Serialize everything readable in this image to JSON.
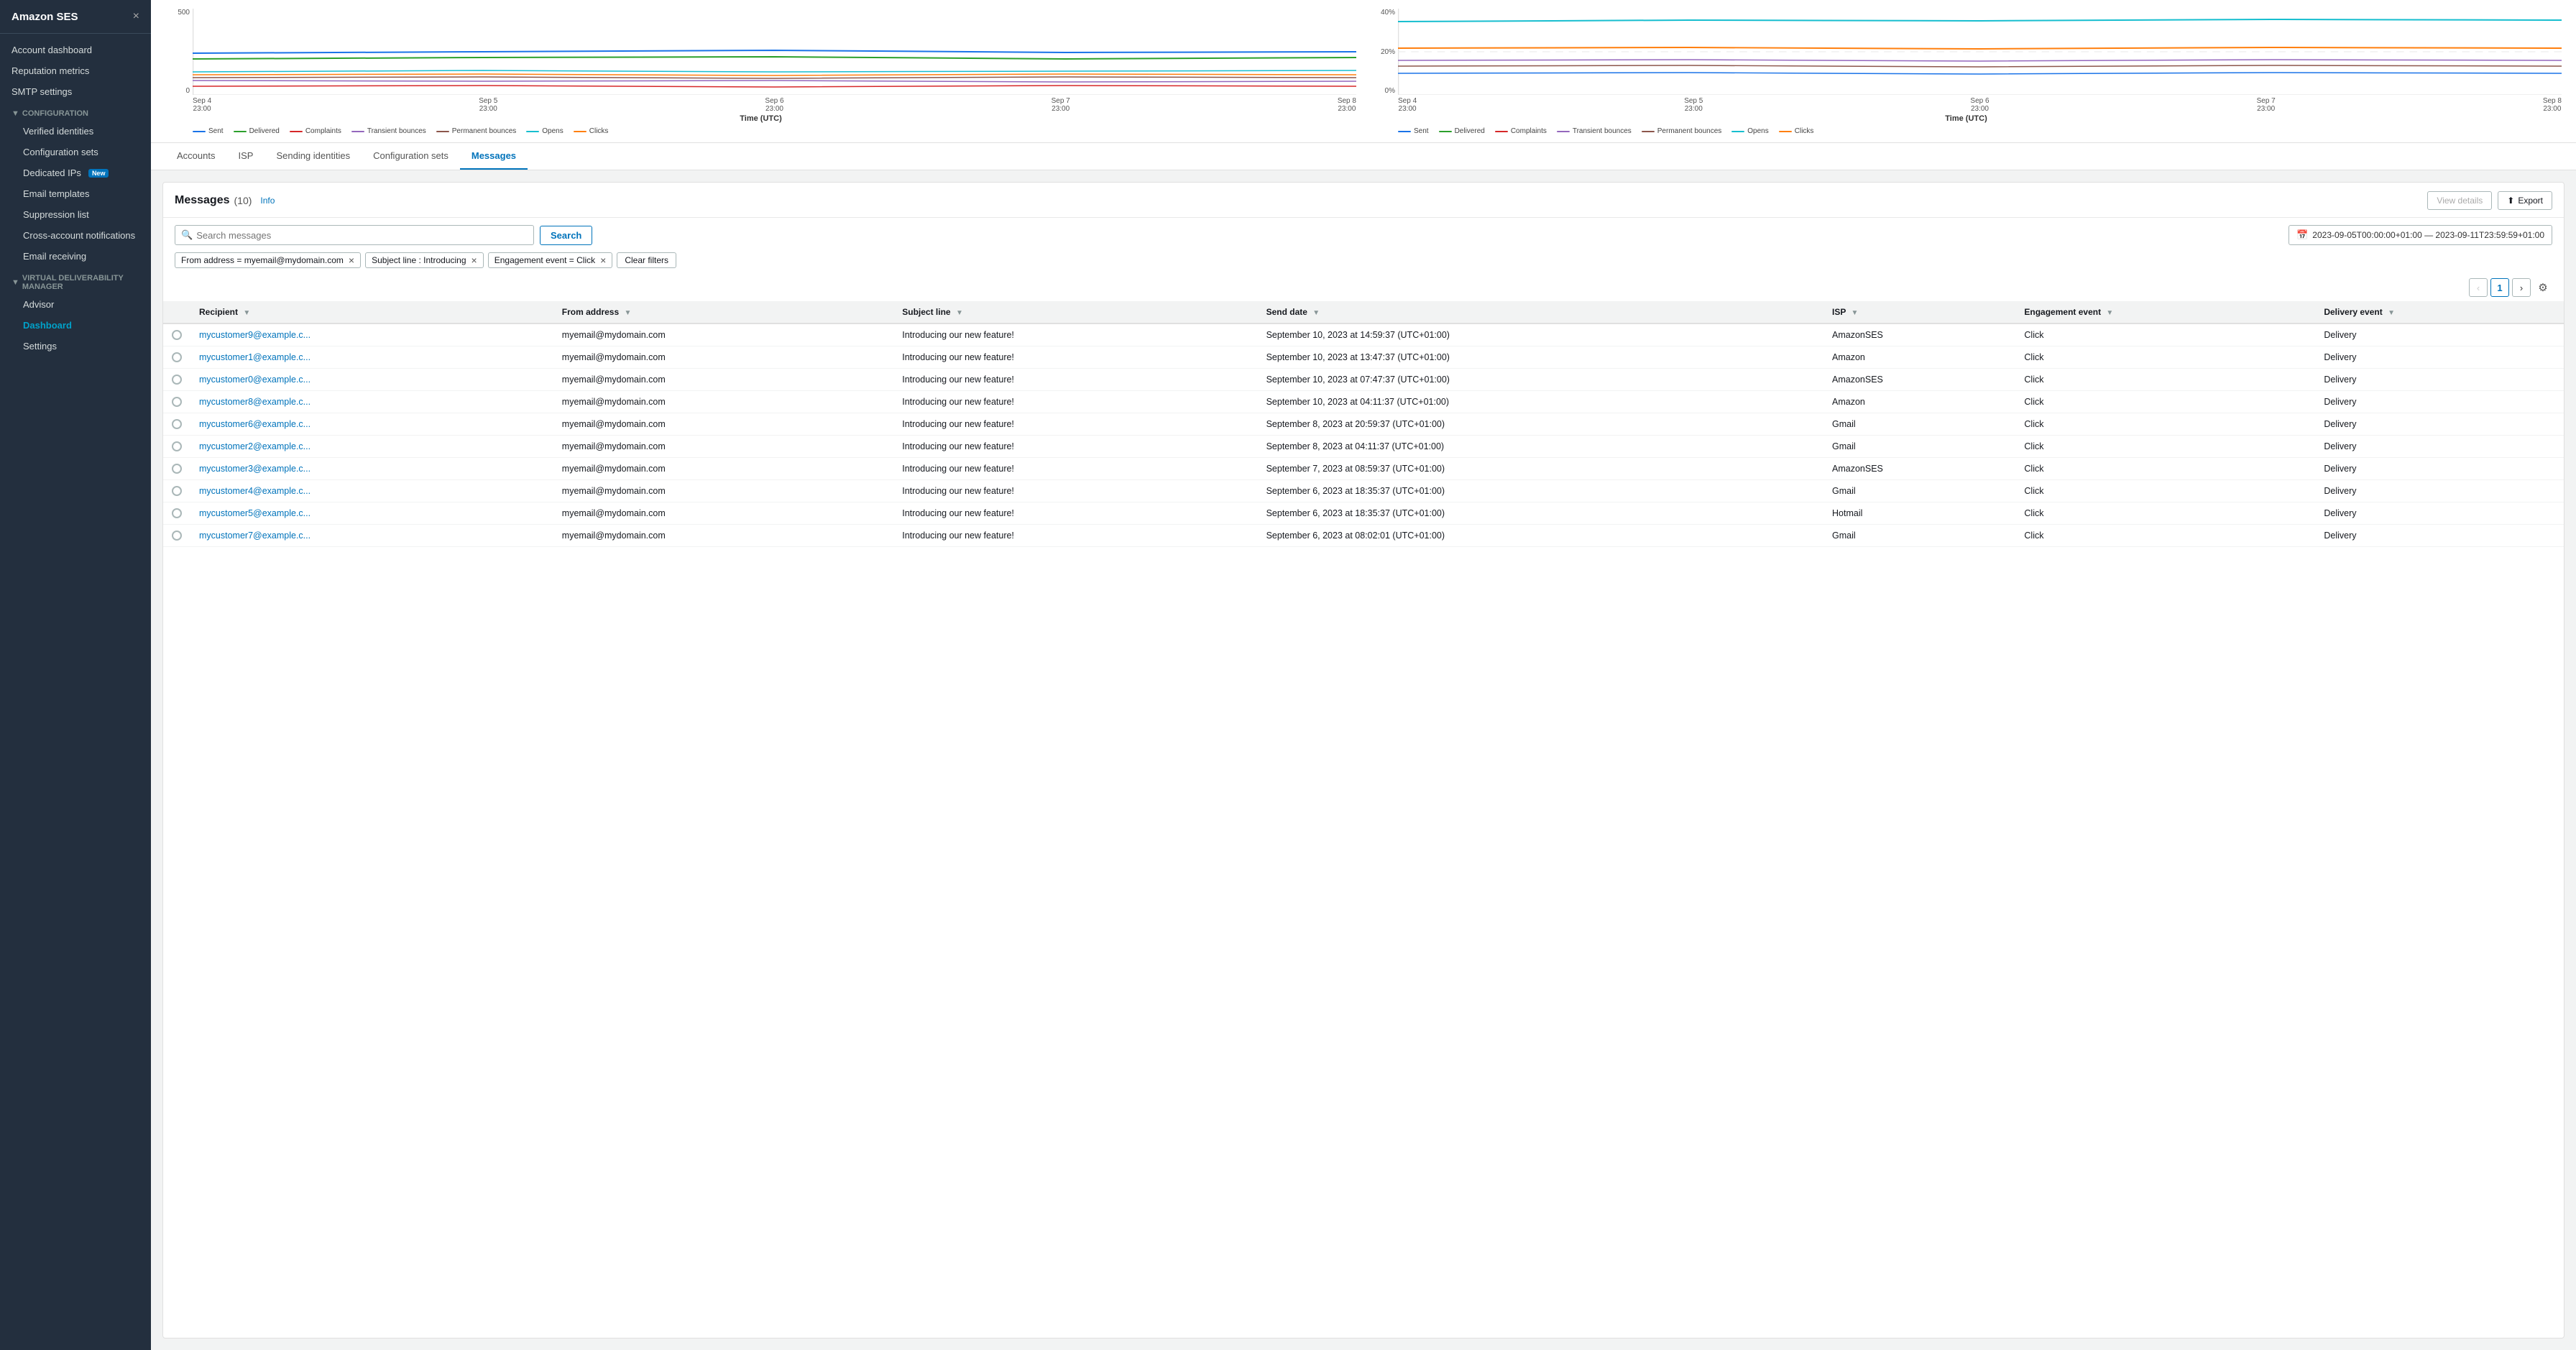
{
  "sidebar": {
    "title": "Amazon SES",
    "close_icon": "×",
    "nav": [
      {
        "id": "account-dashboard",
        "label": "Account dashboard",
        "level": "top"
      },
      {
        "id": "reputation-metrics",
        "label": "Reputation metrics",
        "level": "top"
      },
      {
        "id": "smtp-settings",
        "label": "SMTP settings",
        "level": "top"
      },
      {
        "id": "configuration-section",
        "label": "Configuration",
        "level": "section"
      },
      {
        "id": "verified-identities",
        "label": "Verified identities",
        "level": "sub"
      },
      {
        "id": "configuration-sets",
        "label": "Configuration sets",
        "level": "sub"
      },
      {
        "id": "dedicated-ips",
        "label": "Dedicated IPs",
        "level": "sub",
        "badge": "New"
      },
      {
        "id": "email-templates",
        "label": "Email templates",
        "level": "sub"
      },
      {
        "id": "suppression-list",
        "label": "Suppression list",
        "level": "sub"
      },
      {
        "id": "cross-account-notifications",
        "label": "Cross-account notifications",
        "level": "sub"
      },
      {
        "id": "email-receiving",
        "label": "Email receiving",
        "level": "sub"
      },
      {
        "id": "vdm-section",
        "label": "Virtual Deliverability Manager",
        "level": "section"
      },
      {
        "id": "advisor",
        "label": "Advisor",
        "level": "sub"
      },
      {
        "id": "dashboard",
        "label": "Dashboard",
        "level": "sub",
        "active": true
      },
      {
        "id": "settings",
        "label": "Settings",
        "level": "sub"
      }
    ]
  },
  "charts": {
    "left": {
      "y_labels": [
        "500",
        "0"
      ],
      "x_labels": [
        "Sep 4\n23:00",
        "Sep 5\n23:00",
        "Sep 6\n23:00",
        "Sep 7\n23:00",
        "Sep 8\n23:00"
      ],
      "x_title": "Time (UTC)",
      "legend": [
        {
          "label": "Sent",
          "color": "#1a73e8"
        },
        {
          "label": "Delivered",
          "color": "#2ca02c"
        },
        {
          "label": "Complaints",
          "color": "#d62728"
        },
        {
          "label": "Transient bounces",
          "color": "#9467bd"
        },
        {
          "label": "Permanent bounces",
          "color": "#8c564b"
        },
        {
          "label": "Opens",
          "color": "#17becf"
        },
        {
          "label": "Clicks",
          "color": "#ff7f0e"
        }
      ]
    },
    "right": {
      "y_labels": [
        "40%",
        "20%",
        "0%"
      ],
      "x_labels": [
        "Sep 4\n23:00",
        "Sep 5\n23:00",
        "Sep 6\n23:00",
        "Sep 7\n23:00",
        "Sep 8\n23:00"
      ],
      "x_title": "Time (UTC)",
      "legend": [
        {
          "label": "Sent",
          "color": "#1a73e8"
        },
        {
          "label": "Delivered",
          "color": "#2ca02c"
        },
        {
          "label": "Complaints",
          "color": "#d62728"
        },
        {
          "label": "Transient bounces",
          "color": "#9467bd"
        },
        {
          "label": "Permanent bounces",
          "color": "#8c564b"
        },
        {
          "label": "Opens",
          "color": "#17becf"
        },
        {
          "label": "Clicks",
          "color": "#ff7f0e"
        }
      ]
    }
  },
  "tabs": [
    {
      "id": "accounts",
      "label": "Accounts"
    },
    {
      "id": "isp",
      "label": "ISP"
    },
    {
      "id": "sending-identities",
      "label": "Sending identities"
    },
    {
      "id": "configuration-sets",
      "label": "Configuration sets"
    },
    {
      "id": "messages",
      "label": "Messages",
      "active": true
    }
  ],
  "messages": {
    "title": "Messages",
    "count": "(10)",
    "info_label": "Info",
    "view_details_label": "View details",
    "export_label": "Export",
    "export_icon": "📤",
    "search_placeholder": "Search messages",
    "search_label": "Search",
    "date_range": "2023-09-05T00:00:00+01:00 — 2023-09-11T23:59:59+01:00",
    "filters": [
      {
        "id": "from-address",
        "label": "From address = myemail@mydomain.com"
      },
      {
        "id": "subject-line",
        "label": "Subject line : Introducing"
      },
      {
        "id": "engagement-event",
        "label": "Engagement event = Click"
      }
    ],
    "clear_filters_label": "Clear filters",
    "pagination": {
      "prev_disabled": true,
      "page": "1",
      "next_disabled": false
    },
    "columns": [
      {
        "id": "select",
        "label": ""
      },
      {
        "id": "recipient",
        "label": "Recipient"
      },
      {
        "id": "from-address",
        "label": "From address"
      },
      {
        "id": "subject-line",
        "label": "Subject line"
      },
      {
        "id": "send-date",
        "label": "Send date"
      },
      {
        "id": "isp",
        "label": "ISP"
      },
      {
        "id": "engagement-event",
        "label": "Engagement event"
      },
      {
        "id": "delivery-event",
        "label": "Delivery event"
      }
    ],
    "rows": [
      {
        "recipient": "mycustomer9@example.c...",
        "from": "myemail@mydomain.com",
        "subject": "Introducing our new feature!",
        "send_date": "September 10, 2023 at 14:59:37 (UTC+01:00)",
        "isp": "AmazonSES",
        "engagement": "Click",
        "delivery": "Delivery"
      },
      {
        "recipient": "mycustomer1@example.c...",
        "from": "myemail@mydomain.com",
        "subject": "Introducing our new feature!",
        "send_date": "September 10, 2023 at 13:47:37 (UTC+01:00)",
        "isp": "Amazon",
        "engagement": "Click",
        "delivery": "Delivery"
      },
      {
        "recipient": "mycustomer0@example.c...",
        "from": "myemail@mydomain.com",
        "subject": "Introducing our new feature!",
        "send_date": "September 10, 2023 at 07:47:37 (UTC+01:00)",
        "isp": "AmazonSES",
        "engagement": "Click",
        "delivery": "Delivery"
      },
      {
        "recipient": "mycustomer8@example.c...",
        "from": "myemail@mydomain.com",
        "subject": "Introducing our new feature!",
        "send_date": "September 10, 2023 at 04:11:37 (UTC+01:00)",
        "isp": "Amazon",
        "engagement": "Click",
        "delivery": "Delivery"
      },
      {
        "recipient": "mycustomer6@example.c...",
        "from": "myemail@mydomain.com",
        "subject": "Introducing our new feature!",
        "send_date": "September 8, 2023 at 20:59:37 (UTC+01:00)",
        "isp": "Gmail",
        "engagement": "Click",
        "delivery": "Delivery"
      },
      {
        "recipient": "mycustomer2@example.c...",
        "from": "myemail@mydomain.com",
        "subject": "Introducing our new feature!",
        "send_date": "September 8, 2023 at 04:11:37 (UTC+01:00)",
        "isp": "Gmail",
        "engagement": "Click",
        "delivery": "Delivery"
      },
      {
        "recipient": "mycustomer3@example.c...",
        "from": "myemail@mydomain.com",
        "subject": "Introducing our new feature!",
        "send_date": "September 7, 2023 at 08:59:37 (UTC+01:00)",
        "isp": "AmazonSES",
        "engagement": "Click",
        "delivery": "Delivery"
      },
      {
        "recipient": "mycustomer4@example.c...",
        "from": "myemail@mydomain.com",
        "subject": "Introducing our new feature!",
        "send_date": "September 6, 2023 at 18:35:37 (UTC+01:00)",
        "isp": "Gmail",
        "engagement": "Click",
        "delivery": "Delivery"
      },
      {
        "recipient": "mycustomer5@example.c...",
        "from": "myemail@mydomain.com",
        "subject": "Introducing our new feature!",
        "send_date": "September 6, 2023 at 18:35:37 (UTC+01:00)",
        "isp": "Hotmail",
        "engagement": "Click",
        "delivery": "Delivery"
      },
      {
        "recipient": "mycustomer7@example.c...",
        "from": "myemail@mydomain.com",
        "subject": "Introducing our new feature!",
        "send_date": "September 6, 2023 at 08:02:01 (UTC+01:00)",
        "isp": "Gmail",
        "engagement": "Click",
        "delivery": "Delivery"
      }
    ]
  }
}
